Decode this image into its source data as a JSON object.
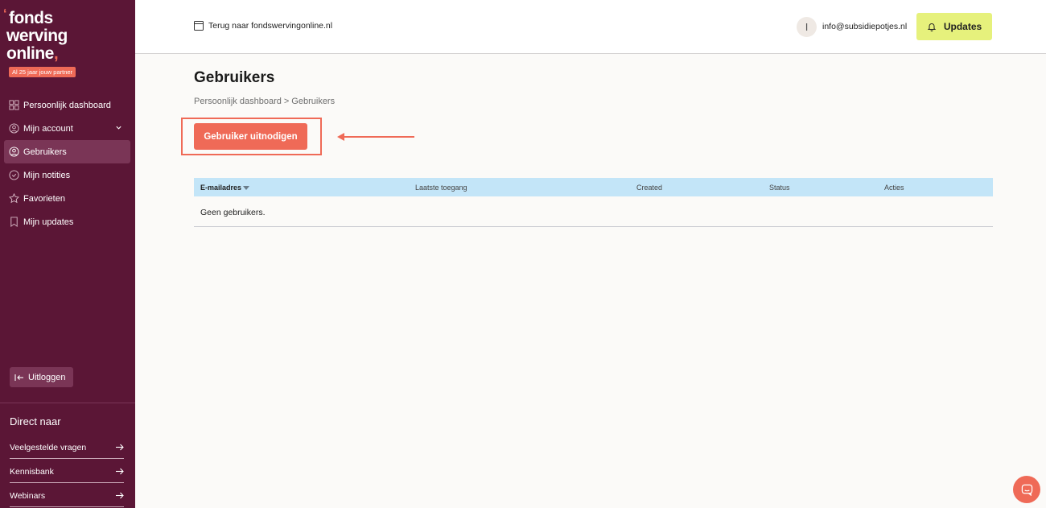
{
  "brand": {
    "logo_mark": "‘",
    "line1": "fonds",
    "line2": "werving",
    "line3": "online",
    "line3_comma": ",",
    "tagline": "Al 25 jaar jouw partner"
  },
  "sidebar": {
    "items": [
      {
        "label": "Persoonlijk dashboard",
        "icon": "dashboard-grid-icon"
      },
      {
        "label": "Mijn account",
        "icon": "user-circle-icon"
      },
      {
        "label": "Gebruikers",
        "icon": "users-icon"
      },
      {
        "label": "Mijn notities",
        "icon": "check-circle-icon"
      },
      {
        "label": "Favorieten",
        "icon": "star-icon"
      },
      {
        "label": "Mijn updates",
        "icon": "bookmark-icon"
      }
    ],
    "logout_label": "Uitloggen",
    "direct_title": "Direct naar",
    "direct_links": [
      {
        "label": "Veelgestelde vragen"
      },
      {
        "label": "Kennisbank"
      },
      {
        "label": "Webinars"
      }
    ]
  },
  "topbar": {
    "back_label": "Terug naar fondswervingonline.nl",
    "avatar_initial": "I",
    "email": "info@subsidiepotjes.nl",
    "updates_label": "Updates"
  },
  "main": {
    "title": "Gebruikers",
    "breadcrumb": {
      "parent": "Persoonlijk dashboard",
      "separator": ">",
      "current": "Gebruikers"
    },
    "invite_label": "Gebruiker uitnodigen",
    "table": {
      "headers": {
        "email": "E-mailadres",
        "last_access": "Laatste toegang",
        "created": "Created",
        "status": "Status",
        "actions": "Acties"
      },
      "empty": "Geen gebruikers."
    }
  },
  "colors": {
    "sidebar_bg": "#5b1636",
    "accent": "#ef6a57",
    "updates_bg": "#e6f17c",
    "table_header_bg": "#c3e5f8"
  }
}
